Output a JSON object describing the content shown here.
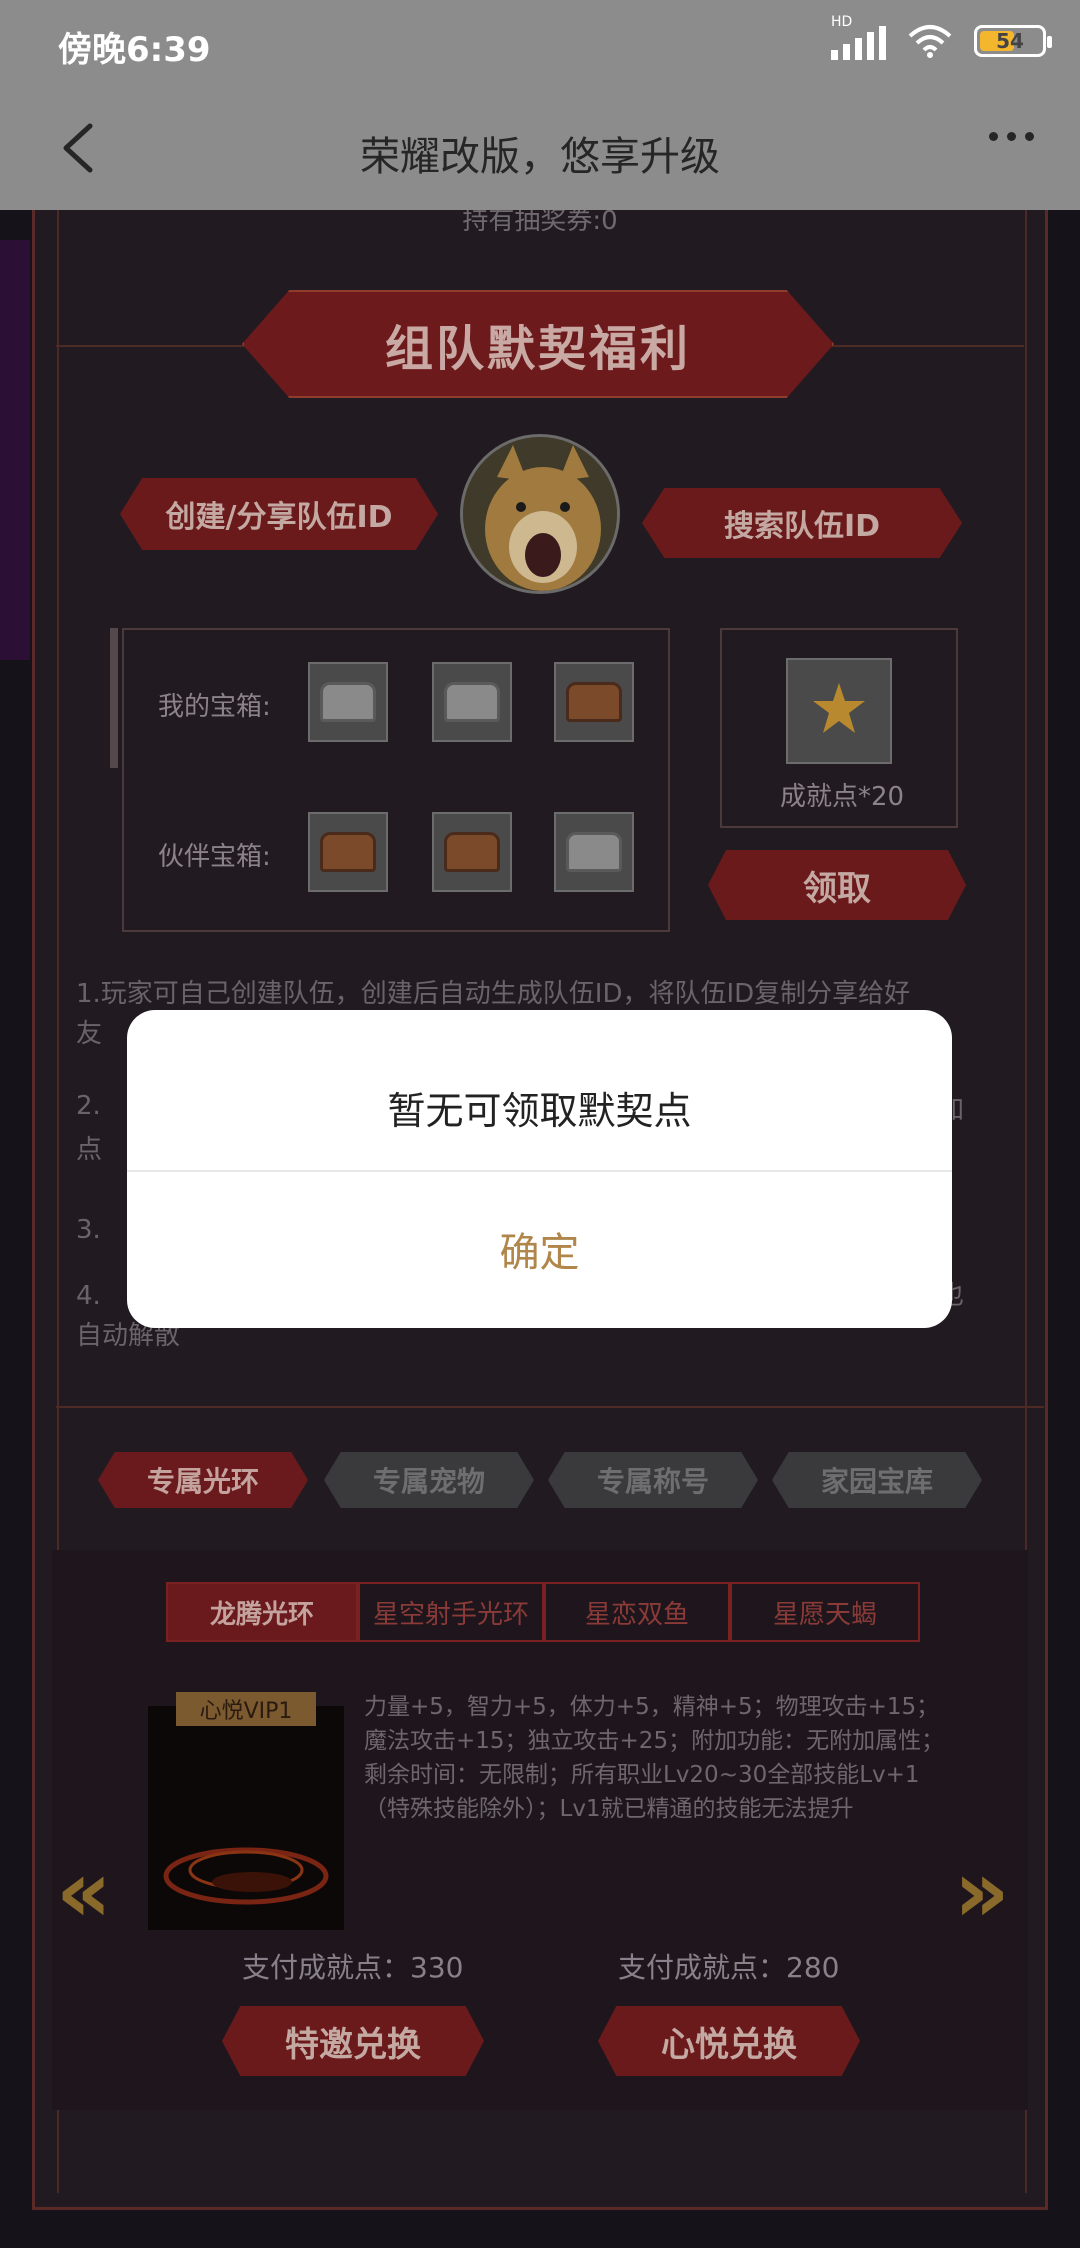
{
  "status_bar": {
    "time": "傍晚6:39",
    "network": "HD",
    "battery": "54"
  },
  "app_bar": {
    "title": "荣耀改版，悠享升级"
  },
  "page": {
    "tickets_text": "持有抽奖券:0",
    "section_title": "组队默契福利",
    "create_share_button": "创建/分享队伍ID",
    "search_team_button": "搜索队伍ID",
    "my_chests_label": "我的宝箱:",
    "partner_chests_label": "伙伴宝箱:",
    "achievement_reward": "成就点*20",
    "claim_button": "领取",
    "rules": [
      "1.玩家可自己创建队伍，创建后自动生成队伍ID，将队伍ID复制分享给好",
      "友",
      "2.",
      "点",
      "3.",
      "4.",
      "自动解散"
    ],
    "rule_fragments": {
      "line2_end": "加",
      "line4_end": "也"
    },
    "main_tabs": [
      "专属光环",
      "专属宠物",
      "专属称号",
      "家园宝库"
    ],
    "sub_tabs": [
      "龙腾光环",
      "星空射手光环",
      "星恋双鱼",
      "星愿天蝎"
    ],
    "vip_badge": "心悦VIP1",
    "item_description": "力量+5，智力+5，体力+5，精神+5；物理攻击+15；魔法攻击+15；独立攻击+25；附加功能：无附加属性；剩余时间：无限制；所有职业Lv20~30全部技能Lv+1（特殊技能除外）；Lv1就已精通的技能无法提升",
    "pay_left": "支付成就点：330",
    "pay_right": "支付成就点：280",
    "exchange_left": "特邀兑换",
    "exchange_right": "心悦兑换"
  },
  "dialog": {
    "message": "暂无可领取默契点",
    "confirm": "确定"
  },
  "colors": {
    "accent_gold": "#b0864a",
    "banner_red": "#6d1a1c",
    "dim_bg": "#8c8c8c"
  }
}
